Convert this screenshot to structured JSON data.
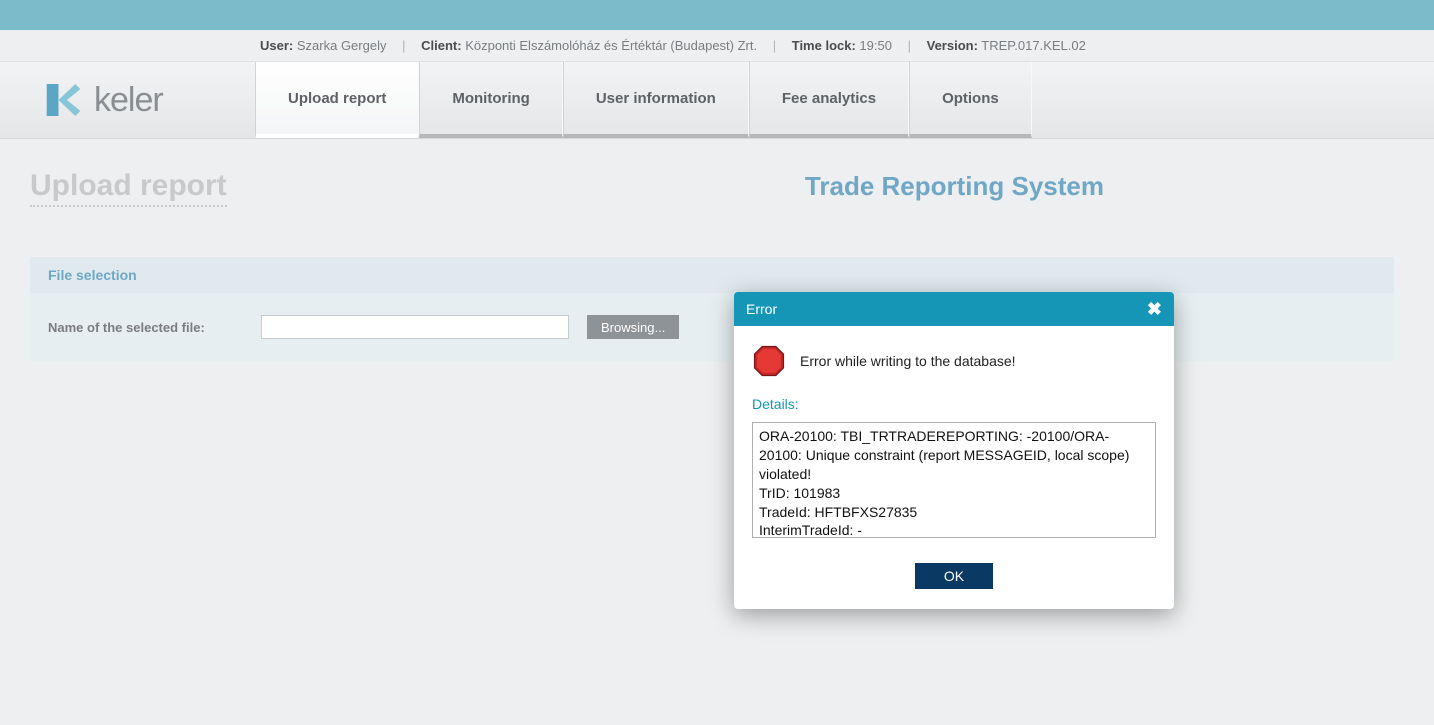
{
  "info_bar": {
    "user_label": "User:",
    "user_value": "Szarka Gergely",
    "client_label": "Client:",
    "client_value": "Központi Elszámolóház és Értéktár (Budapest) Zrt.",
    "timelock_label": "Time lock:",
    "timelock_value": "19:50",
    "version_label": "Version:",
    "version_value": "TREP.017.KEL.02"
  },
  "logo": {
    "text": "keler"
  },
  "nav": {
    "items": [
      {
        "label": "Upload report",
        "active": true
      },
      {
        "label": "Monitoring",
        "active": false
      },
      {
        "label": "User information",
        "active": false
      },
      {
        "label": "Fee analytics",
        "active": false
      },
      {
        "label": "Options",
        "active": false
      }
    ]
  },
  "page": {
    "title_left": "Upload report",
    "title_right": "Trade Reporting System",
    "panel_header": "File selection",
    "field_label": "Name of the selected file:",
    "file_value": "",
    "browse_label": "Browsing..."
  },
  "modal": {
    "title": "Error",
    "message": "Error while writing to the database!",
    "details_label": "Details:",
    "details_text": "ORA-20100: TBI_TRTRADEREPORTING: -20100/ORA-20100: Unique constraint (report MESSAGEID, local scope) violated!\nTrID: 101983\nTradeId: HFTBFXS27835\nInterimTradeId: -",
    "ok_label": "OK"
  }
}
